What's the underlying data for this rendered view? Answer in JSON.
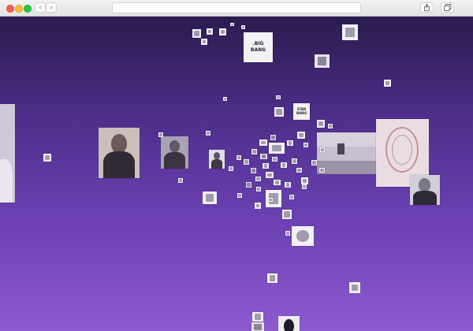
{
  "browser": {
    "nav": {
      "back_glyph": "‹",
      "forward_glyph": "›"
    },
    "address_bar": {
      "value": ""
    },
    "icons": [
      "close-icon",
      "minimize-icon",
      "zoom-icon",
      "chevron-left-icon",
      "chevron-right-icon",
      "share-icon",
      "tabs-icon"
    ]
  },
  "scene": {
    "background_colors": {
      "top": "#2a1b4e",
      "bottom": "#8d5ad0"
    },
    "tiles": {
      "big_bang_card": {
        "line1": ".BIG",
        "line2": "BANG"
      },
      "star_wars_card": {
        "line1": "STAR",
        "line2": "WARS"
      }
    }
  }
}
